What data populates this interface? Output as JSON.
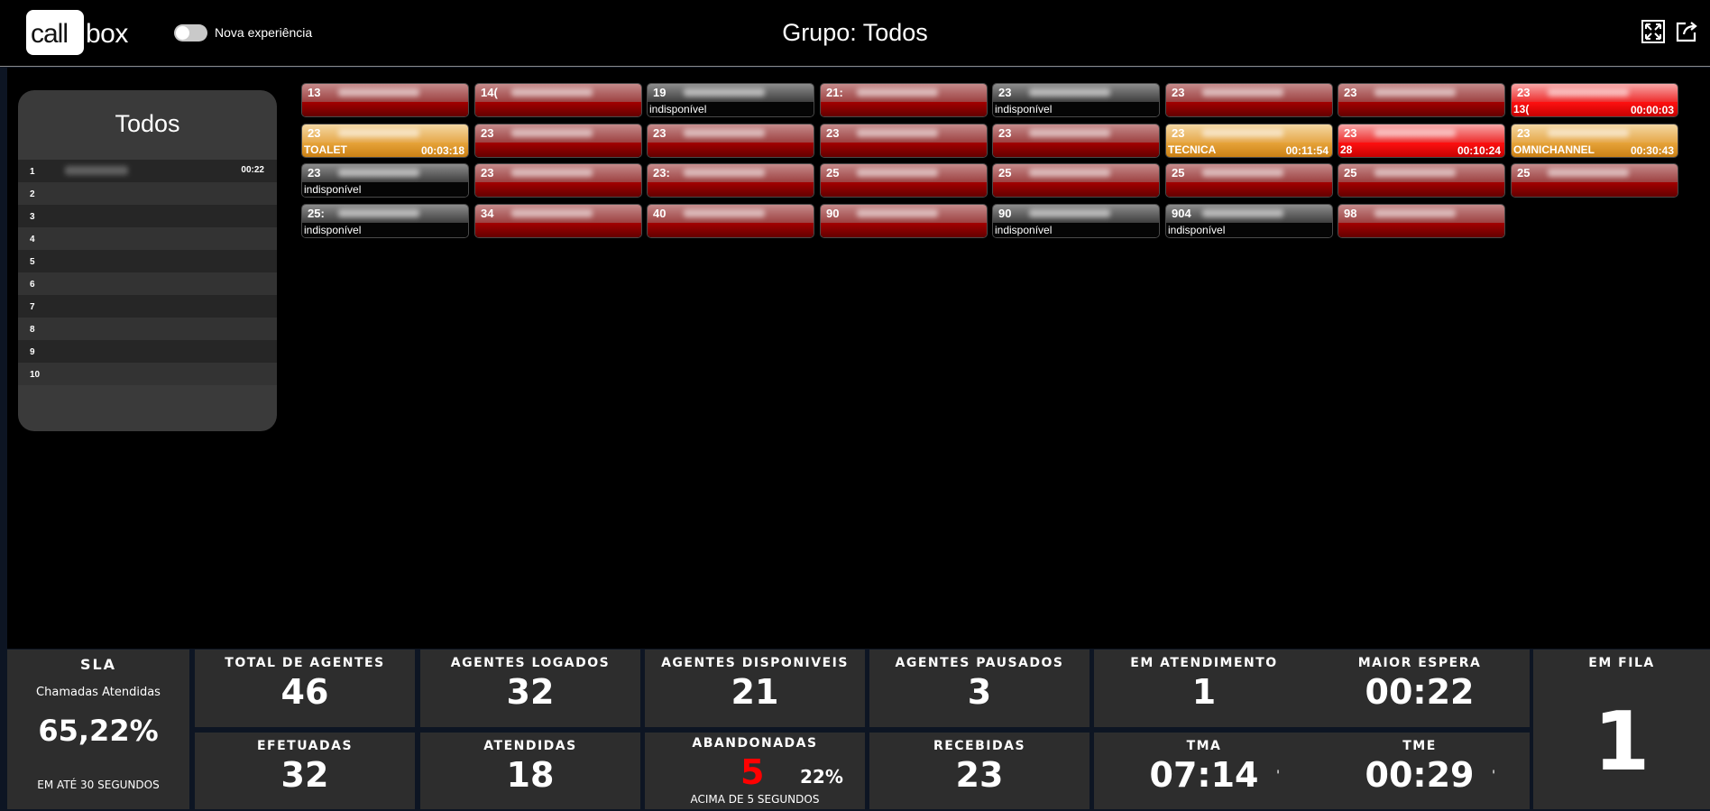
{
  "header": {
    "logo_call": "call",
    "logo_box": "box",
    "toggle_label": "Nova experiência",
    "title": "Grupo: Todos",
    "icons": [
      "expand-icon",
      "share-icon"
    ]
  },
  "queue": {
    "title": "Todos",
    "rows": [
      {
        "n": "1",
        "time": "00:22"
      },
      {
        "n": "2",
        "time": ""
      },
      {
        "n": "3",
        "time": ""
      },
      {
        "n": "4",
        "time": ""
      },
      {
        "n": "5",
        "time": ""
      },
      {
        "n": "6",
        "time": ""
      },
      {
        "n": "7",
        "time": ""
      },
      {
        "n": "8",
        "time": ""
      },
      {
        "n": "9",
        "time": ""
      },
      {
        "n": "10",
        "time": ""
      }
    ]
  },
  "agents": [
    {
      "ext": "13",
      "state": "red",
      "status": "",
      "timer": ""
    },
    {
      "ext": "14(",
      "state": "red",
      "status": "",
      "timer": ""
    },
    {
      "ext": "19",
      "state": "unavail",
      "status": "indisponível",
      "timer": ""
    },
    {
      "ext": "21:",
      "state": "red",
      "status": "",
      "timer": ""
    },
    {
      "ext": "23",
      "state": "unavail",
      "status": "indisponível",
      "timer": ""
    },
    {
      "ext": "23",
      "state": "red",
      "status": "",
      "timer": ""
    },
    {
      "ext": "23",
      "state": "red",
      "status": "",
      "timer": ""
    },
    {
      "ext": "23",
      "state": "bright",
      "status": "13(",
      "timer": "00:00:03"
    },
    {
      "ext": "23",
      "state": "orange",
      "status": "TOALET",
      "timer": "00:03:18"
    },
    {
      "ext": "23",
      "state": "red",
      "status": "",
      "timer": ""
    },
    {
      "ext": "23",
      "state": "red",
      "status": "",
      "timer": ""
    },
    {
      "ext": "23",
      "state": "red",
      "status": "",
      "timer": ""
    },
    {
      "ext": "23",
      "state": "red",
      "status": "",
      "timer": ""
    },
    {
      "ext": "23",
      "state": "orange",
      "status": "TECNICA",
      "timer": "00:11:54"
    },
    {
      "ext": "23",
      "state": "bright",
      "status": "28",
      "timer": "00:10:24"
    },
    {
      "ext": "23",
      "state": "orange",
      "status": "OMNICHANNEL",
      "timer": "00:30:43"
    },
    {
      "ext": "23",
      "state": "unavail",
      "status": "indisponível",
      "timer": ""
    },
    {
      "ext": "23",
      "state": "red",
      "status": "",
      "timer": ""
    },
    {
      "ext": "23:",
      "state": "red",
      "status": "",
      "timer": ""
    },
    {
      "ext": "25",
      "state": "red",
      "status": "",
      "timer": ""
    },
    {
      "ext": "25",
      "state": "red",
      "status": "",
      "timer": ""
    },
    {
      "ext": "25",
      "state": "red",
      "status": "",
      "timer": ""
    },
    {
      "ext": "25",
      "state": "red",
      "status": "",
      "timer": ""
    },
    {
      "ext": "25",
      "state": "red",
      "status": "",
      "timer": ""
    },
    {
      "ext": "25:",
      "state": "unavail",
      "status": "indisponível",
      "timer": ""
    },
    {
      "ext": "34",
      "state": "red",
      "status": "",
      "timer": ""
    },
    {
      "ext": "40",
      "state": "red",
      "status": "",
      "timer": ""
    },
    {
      "ext": "90",
      "state": "red",
      "status": "",
      "timer": ""
    },
    {
      "ext": "90",
      "state": "unavail",
      "status": "indisponível",
      "timer": ""
    },
    {
      "ext": "904",
      "state": "unavail",
      "status": "indisponível",
      "timer": ""
    },
    {
      "ext": "98",
      "state": "red",
      "status": "",
      "timer": ""
    }
  ],
  "colors": {
    "red": "#a30000",
    "orange": "#e6a84a",
    "bright_red": "#ff1010",
    "abandon_red": "#ff0000",
    "panel": "#2d2d2d"
  },
  "stats": {
    "sla": {
      "label": "SLA",
      "sub": "Chamadas Atendidas",
      "value": "65,22%",
      "foot": "EM ATÉ 30 SEGUNDOS"
    },
    "total_agentes": {
      "label": "TOTAL DE AGENTES",
      "value": "46"
    },
    "agentes_logados": {
      "label": "AGENTES LOGADOS",
      "value": "32"
    },
    "agentes_disponiveis": {
      "label": "AGENTES DISPONIVEIS",
      "value": "21"
    },
    "agentes_pausados": {
      "label": "AGENTES PAUSADOS",
      "value": "3"
    },
    "em_atendimento": {
      "label": "EM ATENDIMENTO",
      "value": "1"
    },
    "maior_espera": {
      "label": "MAIOR ESPERA",
      "value": "00:22"
    },
    "em_fila": {
      "label": "EM FILA",
      "value": "1"
    },
    "efetuadas": {
      "label": "EFETUADAS",
      "value": "32"
    },
    "atendidas": {
      "label": "ATENDIDAS",
      "value": "18"
    },
    "abandonadas": {
      "label": "ABANDONADAS",
      "value": "5",
      "pct": "22%",
      "foot": "ACIMA DE 5 SEGUNDOS"
    },
    "recebidas": {
      "label": "RECEBIDAS",
      "value": "23"
    },
    "tma": {
      "label": "TMA",
      "value": "07:14",
      "tick": "'"
    },
    "tme": {
      "label": "TME",
      "value": "00:29",
      "tick": "'"
    }
  }
}
